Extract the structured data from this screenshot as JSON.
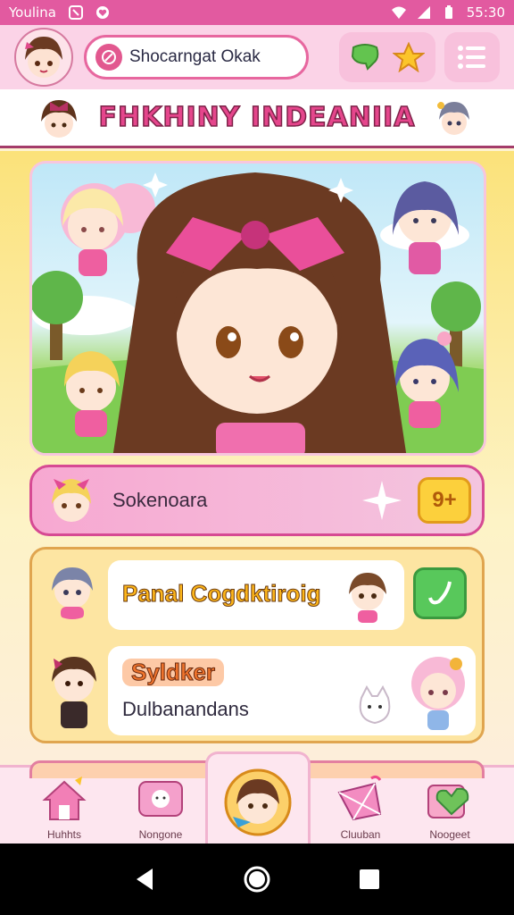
{
  "status_bar": {
    "carrier": "Youlina",
    "time": "55:30"
  },
  "top_bar": {
    "search_text": "Shocarngat Okak"
  },
  "title_bar": {
    "title": "FHKHINY INDEANIIA"
  },
  "featured_card": {
    "label": "Sokenoara",
    "badge": "9+"
  },
  "list": {
    "row1_title": "Panal Cogdktiroig",
    "row2_title": "Syldker",
    "row2_subtitle": "Dulbanandans"
  },
  "tabs": [
    {
      "label": "Huhhts"
    },
    {
      "label": "Nongone"
    },
    {
      "label": ""
    },
    {
      "label": "Cluuban"
    },
    {
      "label": "Noogeet"
    }
  ],
  "colors": {
    "accent": "#e25aa0",
    "pink_light": "#fbd3e7",
    "yellow": "#fbe27a",
    "green": "#58c85b"
  }
}
